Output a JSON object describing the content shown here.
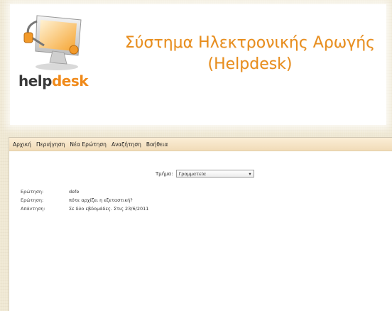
{
  "header": {
    "logo_word_part1": "help",
    "logo_word_part2": "desk",
    "title_line1": "Σύστημα Ηλεκτρονικής Αρωγής",
    "title_line2": "(Helpdesk)"
  },
  "nav": {
    "items": [
      "Αρχική",
      "Περιήγηση",
      "Νέα Ερώτηση",
      "Αναζήτηση",
      "Βοήθεια"
    ]
  },
  "department": {
    "label": "Τμήμα:",
    "selected": "Γραμματεία"
  },
  "entries": [
    {
      "label": "Ερώτηση:",
      "value": "defe"
    },
    {
      "label": "Ερώτηση:",
      "value": "πότε αρχίζει η εξεταστική?"
    },
    {
      "label": "Απάντηση:",
      "value": "Σε δύο εβδομάδες. Στις 23/6/2011"
    }
  ],
  "colors": {
    "title": "#e88e1e",
    "logo_accent": "#f08a1a",
    "navbar": "#f1dcb8"
  }
}
